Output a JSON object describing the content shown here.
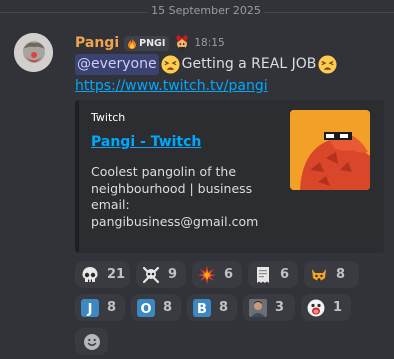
{
  "date_divider": "15 September 2025",
  "message": {
    "username": "Pangi",
    "tag": "PNGI",
    "timestamp": "18:15",
    "mention": "@everyone",
    "text": "Getting a REAL JOB",
    "link": "https://www.twitch.tv/pangi"
  },
  "embed": {
    "provider": "Twitch",
    "title": "Pangi - Twitch",
    "description": "Coolest pangolin of the neighbourhood | business email: pangibusiness@gmail.com"
  },
  "reactions": [
    {
      "icon": "skull-icon",
      "count": "21"
    },
    {
      "icon": "skull-crossbones-icon",
      "count": "9"
    },
    {
      "icon": "collision-icon",
      "count": "6"
    },
    {
      "icon": "receipt-icon",
      "count": "6"
    },
    {
      "icon": "cat-face-icon",
      "count": "8"
    },
    {
      "icon": "letter-j-icon",
      "count": "8"
    },
    {
      "icon": "letter-o-icon",
      "count": "8"
    },
    {
      "icon": "letter-b-icon",
      "count": "8"
    },
    {
      "icon": "portrait-icon",
      "count": "3"
    },
    {
      "icon": "screaming-face-icon",
      "count": "1"
    }
  ],
  "colors": {
    "background": "#323339",
    "username": "#f0a44e",
    "link": "#00a8fc",
    "mention_bg": "#3c4270",
    "reaction_bg": "#393b41"
  }
}
